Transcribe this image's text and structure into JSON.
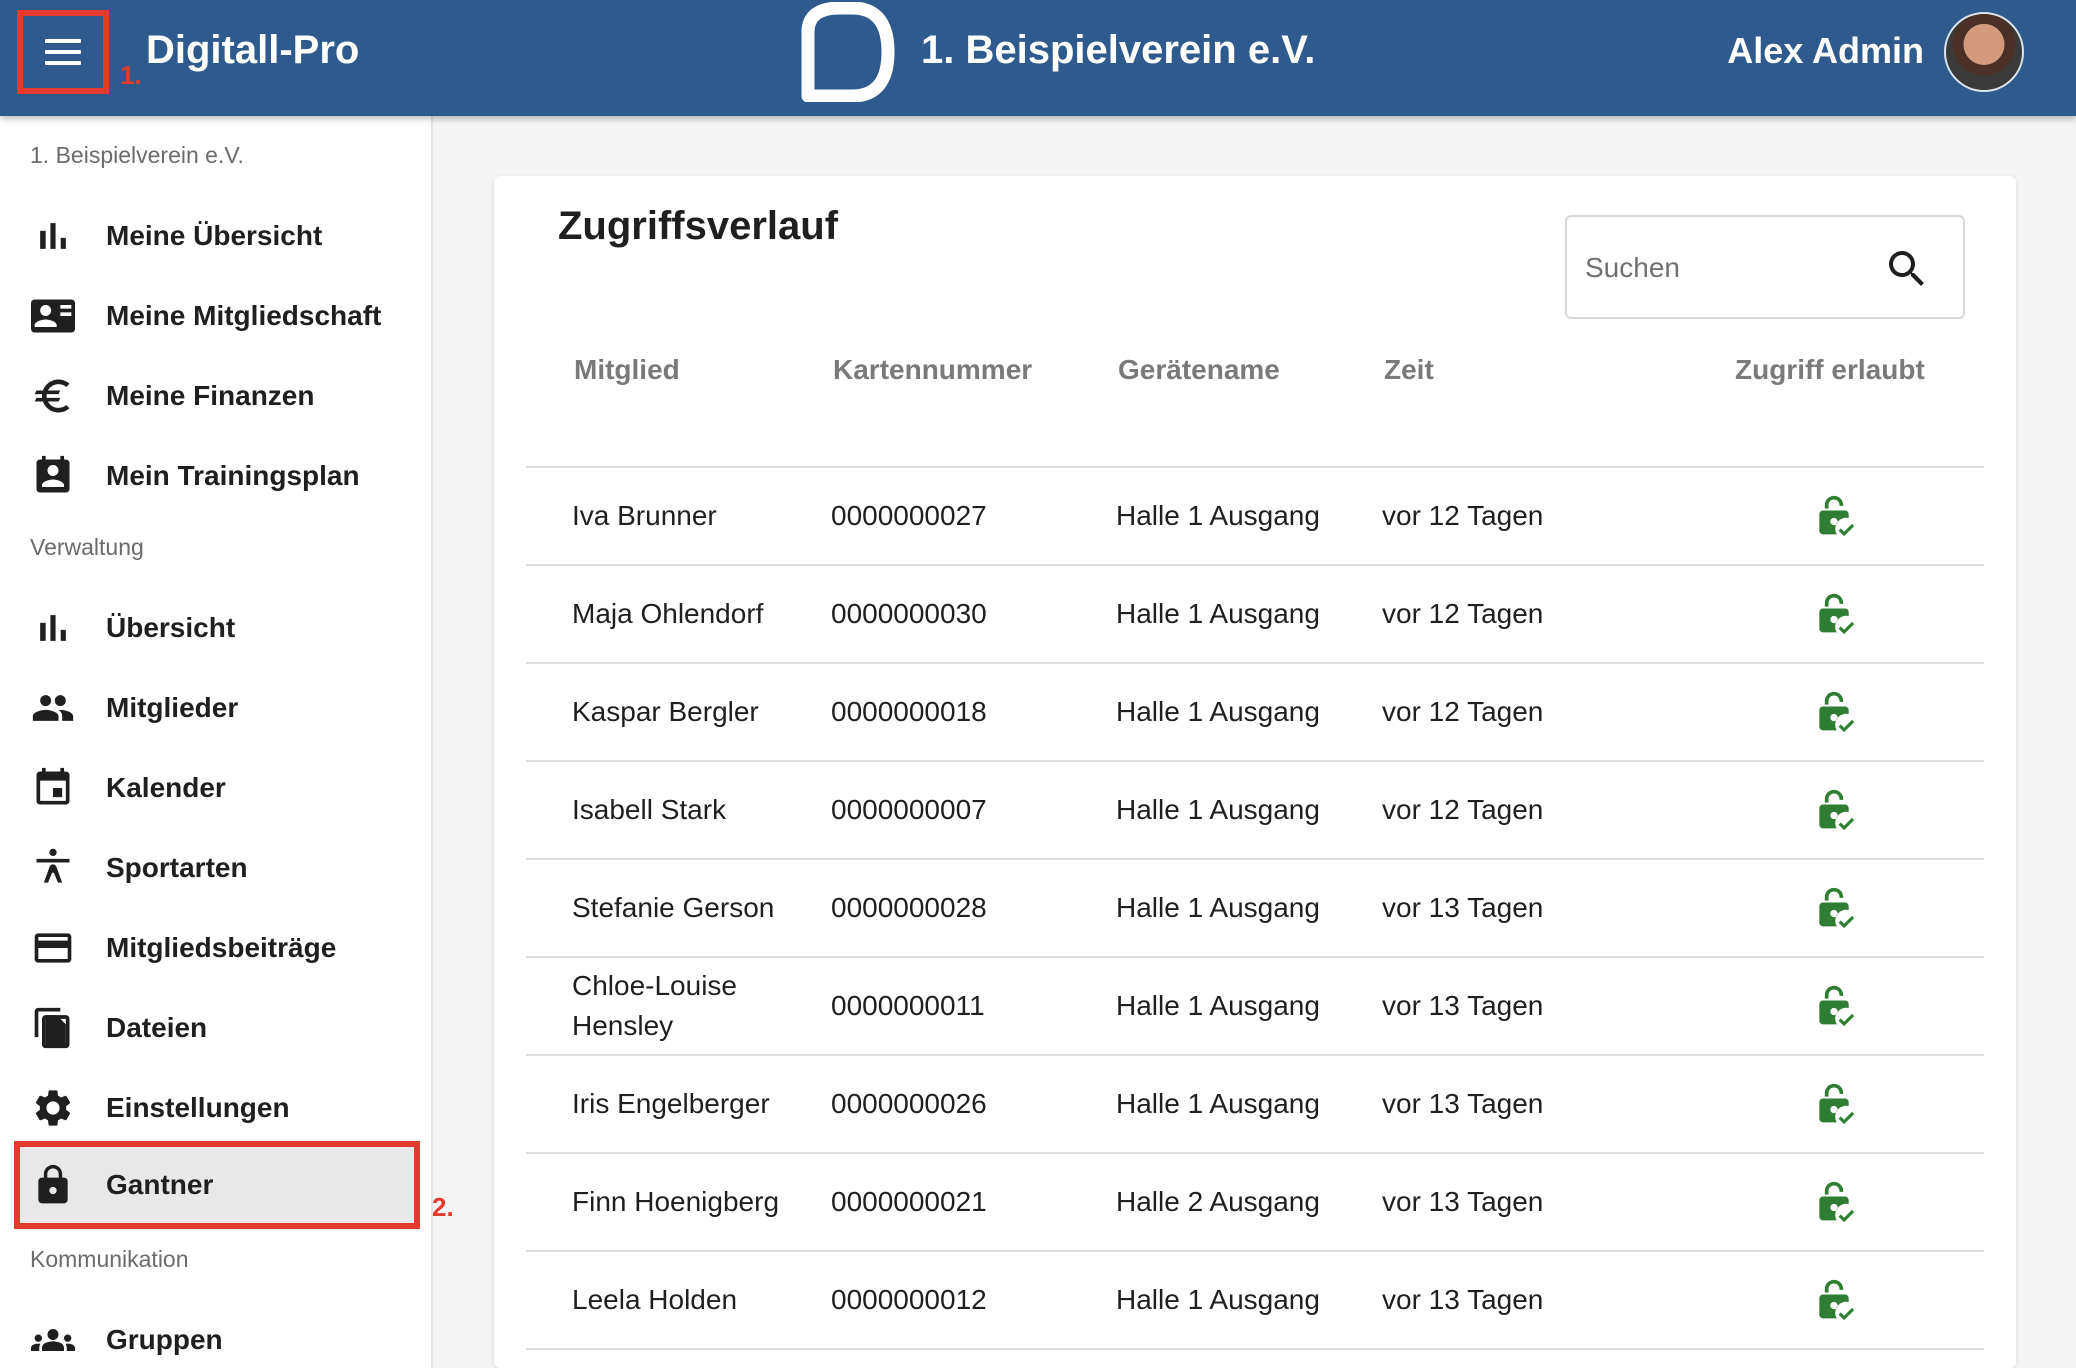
{
  "header": {
    "brand": "Digitall-Pro",
    "club": "1. Beispielverein e.V.",
    "user": "Alex Admin",
    "marker_1": "1.",
    "marker_2": "2."
  },
  "sidebar": {
    "club_label": "1. Beispielverein e.V.",
    "section_admin": "Verwaltung",
    "section_comm": "Kommunikation",
    "items": [
      {
        "label": "Meine Übersicht",
        "icon": "bar-chart-icon"
      },
      {
        "label": "Meine Mitgliedschaft",
        "icon": "id-card-icon"
      },
      {
        "label": "Meine Finanzen",
        "icon": "euro-icon"
      },
      {
        "label": "Mein Trainingsplan",
        "icon": "calendar-person-icon"
      },
      {
        "label": "Übersicht",
        "icon": "bar-chart-icon"
      },
      {
        "label": "Mitglieder",
        "icon": "people-icon"
      },
      {
        "label": "Kalender",
        "icon": "calendar-icon"
      },
      {
        "label": "Sportarten",
        "icon": "sport-icon"
      },
      {
        "label": "Mitgliedsbeiträge",
        "icon": "credit-card-icon"
      },
      {
        "label": "Dateien",
        "icon": "files-icon"
      },
      {
        "label": "Einstellungen",
        "icon": "gear-icon"
      },
      {
        "label": "Gantner",
        "icon": "lock-icon"
      },
      {
        "label": "Gruppen",
        "icon": "groups-icon"
      }
    ]
  },
  "main": {
    "title": "Zugriffsverlauf",
    "search_placeholder": "Suchen",
    "columns": [
      "Mitglied",
      "Kartennummer",
      "Gerätename",
      "Zeit",
      "Zugriff erlaubt"
    ],
    "rows": [
      {
        "name": "Iva Brunner",
        "card": "0000000027",
        "device": "Halle 1 Ausgang",
        "time": "vor 12 Tagen"
      },
      {
        "name": "Maja Ohlendorf",
        "card": "0000000030",
        "device": "Halle 1 Ausgang",
        "time": "vor 12 Tagen"
      },
      {
        "name": "Kaspar Bergler",
        "card": "0000000018",
        "device": "Halle 1 Ausgang",
        "time": "vor 12 Tagen"
      },
      {
        "name": "Isabell Stark",
        "card": "0000000007",
        "device": "Halle 1 Ausgang",
        "time": "vor 12 Tagen"
      },
      {
        "name": "Stefanie Gerson",
        "card": "0000000028",
        "device": "Halle 1 Ausgang",
        "time": "vor 13 Tagen"
      },
      {
        "name": "Chloe-Louise Hensley",
        "card": "0000000011",
        "device": "Halle 1 Ausgang",
        "time": "vor 13 Tagen"
      },
      {
        "name": "Iris Engelberger",
        "card": "0000000026",
        "device": "Halle 1 Ausgang",
        "time": "vor 13 Tagen"
      },
      {
        "name": "Finn Hoenigberg",
        "card": "0000000021",
        "device": "Halle 2 Ausgang",
        "time": "vor 13 Tagen"
      },
      {
        "name": "Leela Holden",
        "card": "0000000012",
        "device": "Halle 1 Ausgang",
        "time": "vor 13 Tagen"
      }
    ]
  },
  "colors": {
    "header_bg": "#2f5a8e",
    "highlight": "#e23b2d",
    "access_granted": "#2e7d32"
  }
}
